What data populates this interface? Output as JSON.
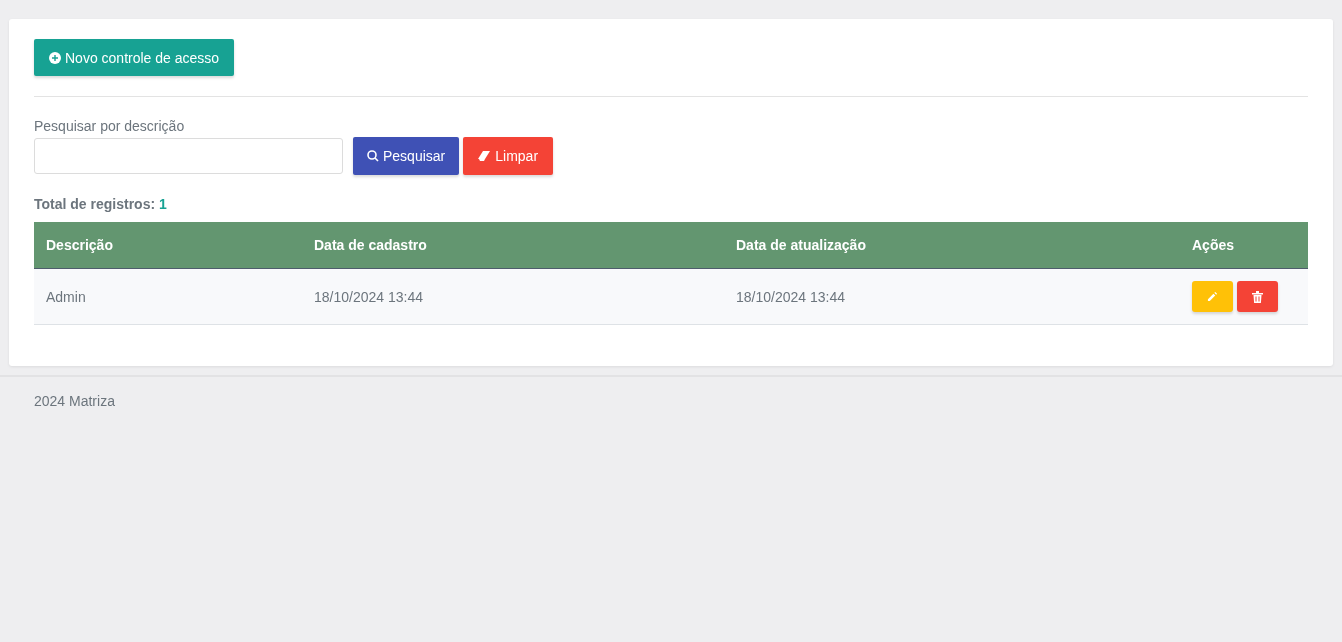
{
  "new_button": {
    "label": "Novo controle de acesso"
  },
  "search": {
    "label": "Pesquisar por descrição",
    "search_button": "Pesquisar",
    "clear_button": "Limpar"
  },
  "total": {
    "label": "Total de registros:",
    "count": "1"
  },
  "table": {
    "columns": [
      "Descrição",
      "Data de cadastro",
      "Data de atualização",
      "Ações"
    ],
    "rows": [
      {
        "cells": [
          "Admin",
          "18/10/2024 13:44",
          "18/10/2024 13:44"
        ]
      }
    ]
  },
  "footer": {
    "text": "2024 Matriza"
  }
}
